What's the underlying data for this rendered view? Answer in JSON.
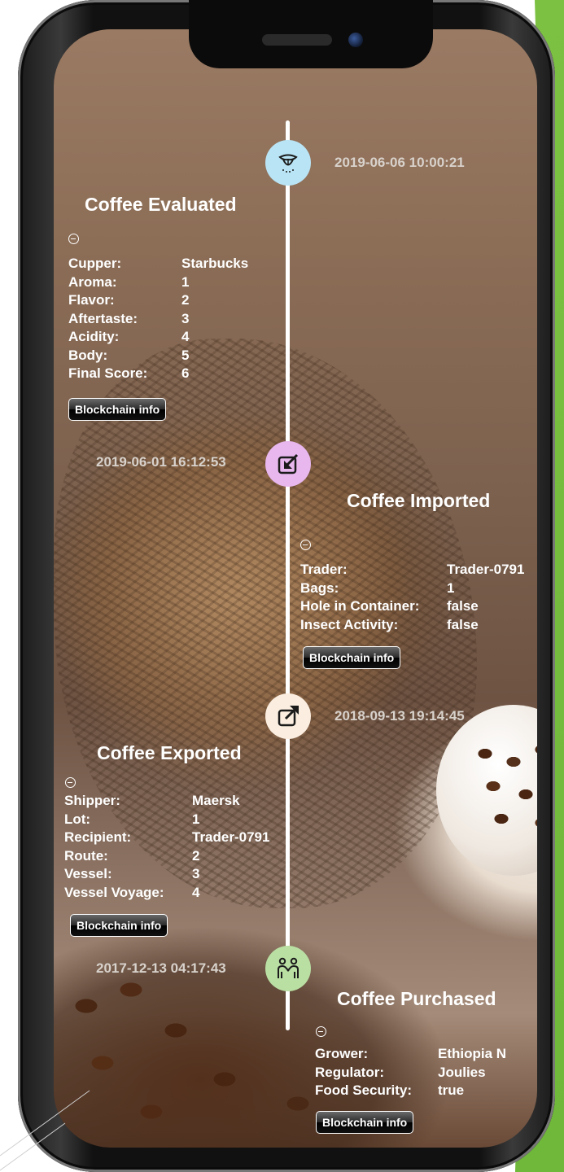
{
  "colors": {
    "evaluated_node": "#b9e4f5",
    "imported_node": "#e7b7ee",
    "exported_node": "#fbeee0",
    "purchased_node": "#b9dfa3",
    "timeline": "#ffffff",
    "accent_green": "#7cc142"
  },
  "events": [
    {
      "icon": "taste-tongue-icon",
      "timestamp": "2019-06-06 10:00:21",
      "title": "Coffee Evaluated",
      "fields": [
        {
          "label": "Cupper:",
          "value": "Starbucks"
        },
        {
          "label": "Aroma:",
          "value": "1"
        },
        {
          "label": "Flavor:",
          "value": "2"
        },
        {
          "label": "Aftertaste:",
          "value": "3"
        },
        {
          "label": "Acidity:",
          "value": "4"
        },
        {
          "label": "Body:",
          "value": "5"
        },
        {
          "label": "Final Score:",
          "value": "6"
        }
      ],
      "button_label": "Blockchain info"
    },
    {
      "icon": "import-arrow-icon",
      "timestamp": "2019-06-01 16:12:53",
      "title": "Coffee Imported",
      "fields": [
        {
          "label": "Trader:",
          "value": "Trader-0791"
        },
        {
          "label": "Bags:",
          "value": "1"
        },
        {
          "label": "Hole in Container:",
          "value": "false"
        },
        {
          "label": "Insect Activity:",
          "value": "false"
        }
      ],
      "button_label": "Blockchain info"
    },
    {
      "icon": "export-arrow-icon",
      "timestamp": "2018-09-13 19:14:45",
      "title": "Coffee Exported",
      "fields": [
        {
          "label": "Shipper:",
          "value": "Maersk"
        },
        {
          "label": "Lot:",
          "value": "1"
        },
        {
          "label": "Recipient:",
          "value": "Trader-0791"
        },
        {
          "label": "Route:",
          "value": "2"
        },
        {
          "label": "Vessel:",
          "value": "3"
        },
        {
          "label": "Vessel Voyage:",
          "value": "4"
        }
      ],
      "button_label": "Blockchain info"
    },
    {
      "icon": "handshake-people-icon",
      "timestamp": "2017-12-13 04:17:43",
      "title": "Coffee Purchased",
      "fields": [
        {
          "label": "Grower:",
          "value": "Ethiopia N"
        },
        {
          "label": "Regulator:",
          "value": "Joulies"
        },
        {
          "label": "Food Security:",
          "value": "true"
        }
      ],
      "button_label": "Blockchain info"
    }
  ]
}
